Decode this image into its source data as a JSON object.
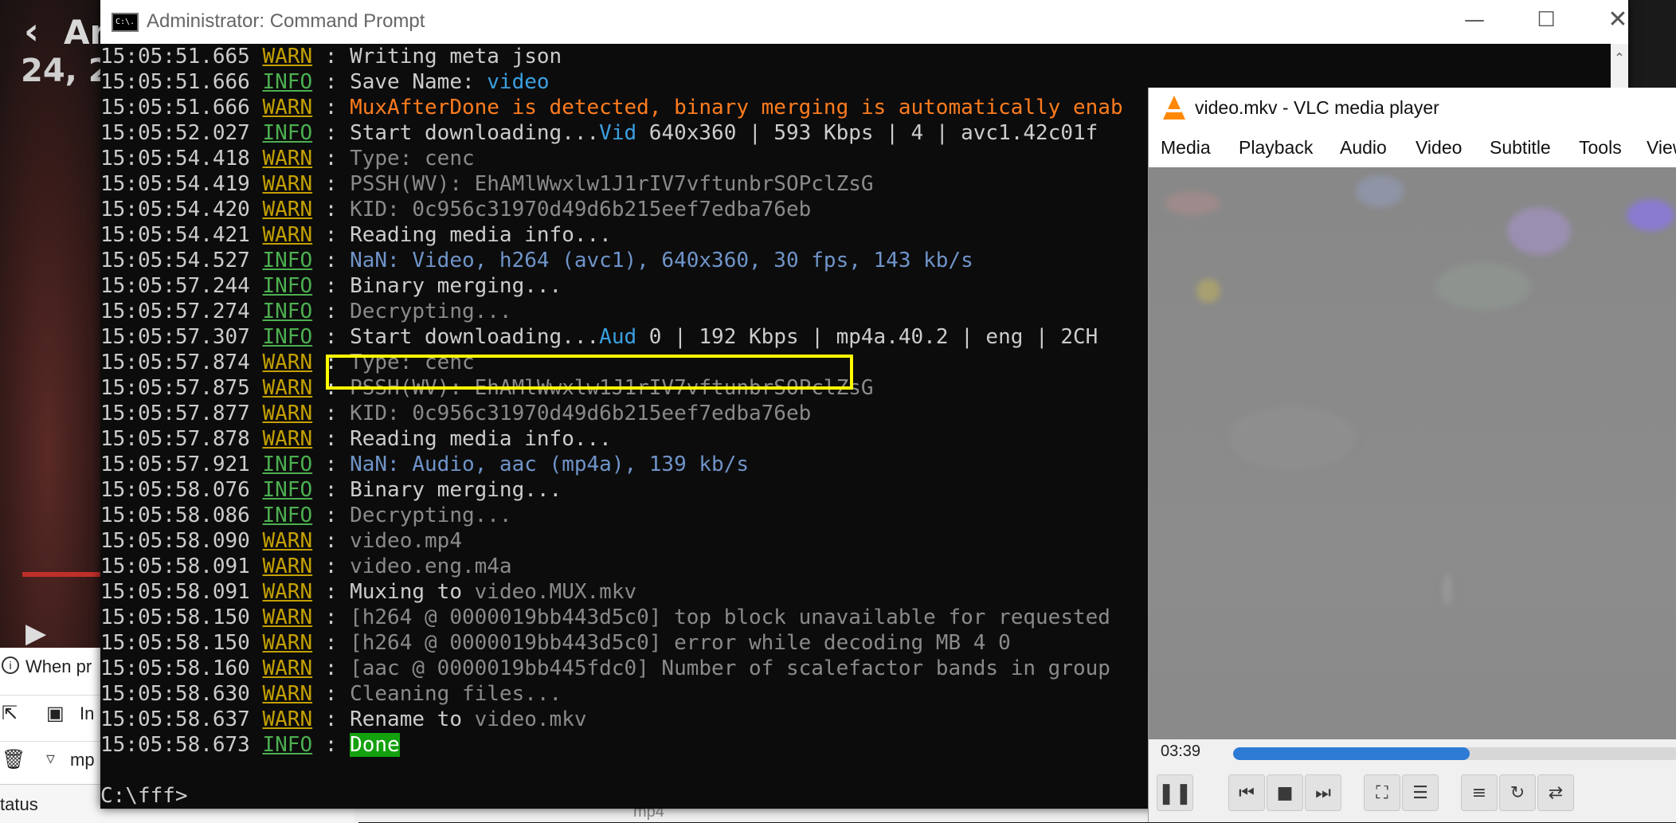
{
  "background_window": {
    "title_fragment": "Ar",
    "subtitle_fragment": "24, 2",
    "when_text": "When pr",
    "tool_text": "In",
    "filter_text": "mp",
    "status_text": "tatus",
    "file_fragment": "mp4"
  },
  "cmd": {
    "title": "Administrator: Command Prompt",
    "icon_label": "C:\\.",
    "lines": [
      {
        "ts": "15:05:51.665",
        "level": "WARN",
        "segments": [
          {
            "t": "Writing meta json",
            "c": "normal"
          }
        ]
      },
      {
        "ts": "15:05:51.666",
        "level": "INFO",
        "segments": [
          {
            "t": "Save Name: ",
            "c": "normal"
          },
          {
            "t": "video",
            "c": "blue"
          }
        ]
      },
      {
        "ts": "15:05:51.666",
        "level": "WARN",
        "segments": [
          {
            "t": "MuxAfterDone is detected, binary merging is automatically enab",
            "c": "orange"
          }
        ]
      },
      {
        "ts": "15:05:52.027",
        "level": "INFO",
        "segments": [
          {
            "t": "Start downloading...",
            "c": "normal"
          },
          {
            "t": "Vid",
            "c": "blue"
          },
          {
            "t": " 640x360 | 593 Kbps | 4 | avc1.42c01f",
            "c": "normal"
          }
        ]
      },
      {
        "ts": "15:05:54.418",
        "level": "WARN",
        "segments": [
          {
            "t": "Type: cenc",
            "c": "dim"
          }
        ]
      },
      {
        "ts": "15:05:54.419",
        "level": "WARN",
        "segments": [
          {
            "t": "PSSH(WV): EhAMlWwxlw1J1rIV7vftunbrSOPclZsG",
            "c": "dim"
          }
        ]
      },
      {
        "ts": "15:05:54.420",
        "level": "WARN",
        "segments": [
          {
            "t": "KID: 0c956c31970d49d6b215eef7edba76eb",
            "c": "dim"
          }
        ]
      },
      {
        "ts": "15:05:54.421",
        "level": "WARN",
        "segments": [
          {
            "t": "Reading media info...",
            "c": "normal"
          }
        ]
      },
      {
        "ts": "15:05:54.527",
        "level": "INFO",
        "segments": [
          {
            "t": "NaN: Video, h264 (avc1), 640x360, 30 fps, 143 kb/s",
            "c": "steel"
          }
        ]
      },
      {
        "ts": "15:05:57.244",
        "level": "INFO",
        "segments": [
          {
            "t": "Binary merging...",
            "c": "normal"
          }
        ]
      },
      {
        "ts": "15:05:57.274",
        "level": "INFO",
        "segments": [
          {
            "t": "Decrypting...",
            "c": "dim"
          }
        ]
      },
      {
        "ts": "15:05:57.307",
        "level": "INFO",
        "segments": [
          {
            "t": "Start downloading...",
            "c": "normal"
          },
          {
            "t": "Aud",
            "c": "blue"
          },
          {
            "t": " 0 | 192 Kbps | mp4a.40.2 | eng | 2CH",
            "c": "normal"
          }
        ]
      },
      {
        "ts": "15:05:57.874",
        "level": "WARN",
        "segments": [
          {
            "t": "Type: cenc",
            "c": "dim"
          }
        ]
      },
      {
        "ts": "15:05:57.875",
        "level": "WARN",
        "segments": [
          {
            "t": "PSSH(WV): EhAMlWwxlw1J1rIV7vftunbrSOPclZsG",
            "c": "dim"
          }
        ]
      },
      {
        "ts": "15:05:57.877",
        "level": "WARN",
        "segments": [
          {
            "t": "KID: 0c956c31970d49d6b215eef7edba76eb",
            "c": "dim"
          }
        ]
      },
      {
        "ts": "15:05:57.878",
        "level": "WARN",
        "segments": [
          {
            "t": "Reading media info...",
            "c": "normal"
          }
        ]
      },
      {
        "ts": "15:05:57.921",
        "level": "INFO",
        "segments": [
          {
            "t": "NaN: Audio, aac (mp4a), 139 kb/s",
            "c": "steel"
          }
        ]
      },
      {
        "ts": "15:05:58.076",
        "level": "INFO",
        "segments": [
          {
            "t": "Binary merging...",
            "c": "normal"
          }
        ]
      },
      {
        "ts": "15:05:58.086",
        "level": "INFO",
        "segments": [
          {
            "t": "Decrypting...",
            "c": "dim"
          }
        ]
      },
      {
        "ts": "15:05:58.090",
        "level": "WARN",
        "segments": [
          {
            "t": "video.mp4",
            "c": "dim"
          }
        ]
      },
      {
        "ts": "15:05:58.091",
        "level": "WARN",
        "segments": [
          {
            "t": "video.eng.m4a",
            "c": "dim"
          }
        ]
      },
      {
        "ts": "15:05:58.091",
        "level": "WARN",
        "segments": [
          {
            "t": "Muxing to ",
            "c": "normal"
          },
          {
            "t": "video.MUX.mkv",
            "c": "dim"
          }
        ]
      },
      {
        "ts": "15:05:58.150",
        "level": "WARN",
        "segments": [
          {
            "t": "[h264 @ 0000019bb443d5c0] top block unavailable for requested",
            "c": "dim"
          }
        ]
      },
      {
        "ts": "15:05:58.150",
        "level": "WARN",
        "segments": [
          {
            "t": "[h264 @ 0000019bb443d5c0] error while decoding MB 4 0",
            "c": "dim"
          }
        ]
      },
      {
        "ts": "15:05:58.160",
        "level": "WARN",
        "segments": [
          {
            "t": "[aac @ 0000019bb445fdc0] Number of scalefactor bands in group",
            "c": "dim"
          }
        ]
      },
      {
        "ts": "15:05:58.630",
        "level": "WARN",
        "segments": [
          {
            "t": "Cleaning files...",
            "c": "dim"
          }
        ]
      },
      {
        "ts": "15:05:58.637",
        "level": "WARN",
        "segments": [
          {
            "t": "Rename to ",
            "c": "normal"
          },
          {
            "t": "video.mkv",
            "c": "dim"
          }
        ]
      },
      {
        "ts": "15:05:58.673",
        "level": "INFO",
        "segments": [
          {
            "t": "Done",
            "c": "done"
          }
        ]
      }
    ],
    "prompt": "C:\\fff>",
    "highlighted_line_index": 14
  },
  "vlc": {
    "title": "video.mkv - VLC media player",
    "menu": [
      "Media",
      "Playback",
      "Audio",
      "Video",
      "Subtitle",
      "Tools",
      "View"
    ],
    "time_elapsed": "03:39",
    "progress_fraction": 0.53,
    "accent_color": "#2e7bd6"
  }
}
